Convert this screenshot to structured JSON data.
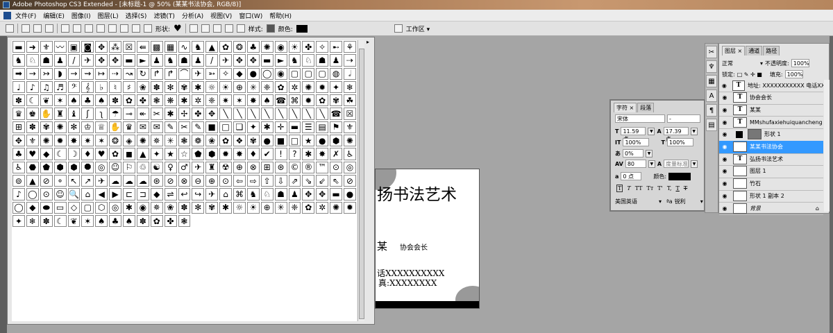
{
  "title": "Adobe Photoshop CS3 Extended - [未标题-1 @ 50% (某某书法协会, RGB/8)]",
  "menu": [
    "文件(F)",
    "编辑(E)",
    "图像(I)",
    "图层(L)",
    "选择(S)",
    "滤镜(T)",
    "分析(A)",
    "视图(V)",
    "窗口(W)",
    "帮助(H)"
  ],
  "options": {
    "shape_label": "形状:",
    "style_label": "样式:",
    "color_label": "颜色:",
    "workspace": "工作区 ▾"
  },
  "shapes": [
    "▬",
    "➜",
    "⚜",
    "〰",
    "▣",
    "◙",
    "✥",
    "⁂",
    "☒",
    "⇚",
    "▩",
    "▦",
    "∿",
    "♞",
    "▲",
    "✿",
    "❂",
    "♣",
    "✺",
    "◉",
    "☀",
    "✤",
    "✧",
    "➸",
    "⚘",
    "♞",
    "♘",
    "☗",
    "♟",
    "/",
    "✈",
    "✥",
    "✥",
    "▬",
    "►",
    "♟",
    "♞",
    "☗",
    "♟",
    "/",
    "✈",
    "✥",
    "✥",
    "▬",
    "►",
    "♞",
    "♘",
    "☗",
    "♟",
    "⇢",
    "➡",
    "→",
    "↣",
    "◗",
    "→",
    "⇝",
    "↦",
    "⇢",
    "↝",
    "↻",
    "↱",
    "↱",
    "⌒",
    "✈",
    "➳",
    "✧",
    "◆",
    "●",
    "◯",
    "◉",
    "▢",
    "▢",
    "▢",
    "◍",
    "𝅗𝅥",
    "♩",
    "♪",
    "♫",
    "♬",
    "𝄢",
    "𝄞",
    "♭",
    "♮",
    "♯",
    "❀",
    "✽",
    "✻",
    "✾",
    "✱",
    "☼",
    "☀",
    "⊕",
    "✳",
    "❈",
    "✿",
    "✲",
    "✺",
    "✹",
    "✦",
    "❄",
    "✽",
    "☾",
    "❦",
    "✶",
    "♠",
    "♣",
    "♠",
    "✽",
    "✿",
    "✤",
    "❃",
    "❋",
    "✱",
    "✲",
    "❈",
    "✷",
    "✶",
    "✸",
    "♠",
    "☎",
    "⌘",
    "✹",
    "✿",
    "✾",
    "☘",
    "♛",
    "♚",
    "✋",
    "♜",
    "♝",
    "ʃ",
    "ʅ",
    "☂",
    "⊸",
    "↞",
    "✂",
    "✱",
    "✢",
    "✤",
    "✥",
    "╲",
    "╲",
    "╲",
    "╲",
    "╲",
    "╲",
    "╲",
    "╲",
    "☎",
    "☒",
    "⊞",
    "✽",
    "✾",
    "✺",
    "✻",
    "♔",
    "♕",
    "✋",
    "♛",
    "✉",
    "✉",
    "✎",
    "✂",
    "✎",
    "■",
    "□",
    "❏",
    "✦",
    "✱",
    "✛",
    "▬",
    "☰",
    "▤",
    "⚑",
    "⚜",
    "✥",
    "⚜",
    "✺",
    "✹",
    "✸",
    "✷",
    "✶",
    "❂",
    "◈",
    "✺",
    "✵",
    "✳",
    "❃",
    "❁",
    "❀",
    "✿",
    "❖",
    "✾",
    "●",
    "■",
    "□",
    "★",
    "●",
    "⬢",
    "✺",
    "♣",
    "♥",
    "◆",
    "☾",
    "☽",
    "♦",
    "♥",
    "✿",
    "◼",
    "▲",
    "✦",
    "★",
    "☆",
    "⬟",
    "⬢",
    "✹",
    "✸",
    "♦",
    "✔",
    "!",
    "?",
    "✱",
    "✸",
    "✗",
    "♿",
    "♿",
    "⬣",
    "⬟",
    "⬢",
    "⬢",
    "⯃",
    "◎",
    "☺",
    "⚐",
    "♲",
    "☯",
    "♀",
    "♂",
    "✈",
    "♜",
    "☢",
    "⊕",
    "⊗",
    "⊞",
    "⊛",
    "©",
    "®",
    "™",
    "⊙",
    "◎",
    "⊚",
    "▲",
    "⊘",
    "⚬",
    "↖",
    "↗",
    "✈",
    "☁",
    "☁",
    "☁",
    "⊛",
    "⊘",
    "⊗",
    "⊖",
    "⊕",
    "⊙",
    "⇦",
    "⇨",
    "⇧",
    "⇩",
    "⇗",
    "⇘",
    "⇙",
    "⇖",
    "⊘",
    "♪",
    "◯",
    "⊙",
    "☺",
    "🔍",
    "⌂",
    "◀",
    "▶",
    "⊏",
    "⊐",
    "◆",
    "⇌",
    "↩",
    "↪",
    "✈",
    "⌂",
    "⌘",
    "♞",
    "♘",
    "☗",
    "♟",
    "✥",
    "✥",
    "▬",
    "●",
    "◯",
    "◆",
    "⬬",
    "▭",
    "◇",
    "▢",
    "⬡",
    "◎",
    "✱",
    "◉",
    "✵",
    "❀",
    "✽",
    "✻",
    "✾",
    "✱",
    "☼",
    "☀",
    "⊕",
    "✳",
    "❈",
    "✿",
    "✲",
    "✺",
    "✹",
    "✦",
    "❄",
    "✽",
    "☾",
    "❦",
    "✶",
    "♠",
    "♣",
    "♠",
    "✽",
    "✿",
    "✤",
    "❃"
  ],
  "canvas": {
    "title_text": "扬书法艺术",
    "name": "某",
    "position": "协会会长",
    "phone": "话XXXXXXXXXX",
    "fax": "真:XXXXXXXX"
  },
  "character": {
    "tabs": [
      "字符 ×",
      "段落"
    ],
    "font": "宋体",
    "style": "-",
    "size": "11.59 点",
    "leading": "17.39 点",
    "vscale": "100%",
    "hscale": "100%",
    "tracking_pct": "0%",
    "kerning": "80",
    "kerning_mode": "度量标准",
    "baseline": "0 点",
    "color_label": "颜色:",
    "language": "美国英语",
    "aa": "锐利",
    "styles": [
      "T",
      "T",
      "TT",
      "Tт",
      "T'",
      "T,",
      "T",
      "T"
    ]
  },
  "layers": {
    "tabs": [
      "图层 ×",
      "通道",
      "路径"
    ],
    "blend": "正常",
    "opacity_label": "不透明度:",
    "opacity": "100%",
    "lock_label": "锁定:",
    "fill_label": "填充:",
    "fill": "100%",
    "items": [
      {
        "name": "地址: XXXXXXXXXXX 电话XX...",
        "type": "text"
      },
      {
        "name": "协会会长",
        "type": "text"
      },
      {
        "name": "某某",
        "type": "text"
      },
      {
        "name": "MMshufaxiehuiquancheng",
        "type": "text"
      },
      {
        "name": "形状 1",
        "type": "shape"
      },
      {
        "name": "某某书法协会",
        "type": "text",
        "selected": true
      },
      {
        "name": "弘扬书法艺术",
        "type": "text"
      },
      {
        "name": "图层 1",
        "type": "pixel"
      },
      {
        "name": "竹石",
        "type": "pixel"
      },
      {
        "name": "形状 1 副本 2",
        "type": "pixel"
      },
      {
        "name": "背景",
        "type": "bg"
      }
    ]
  }
}
